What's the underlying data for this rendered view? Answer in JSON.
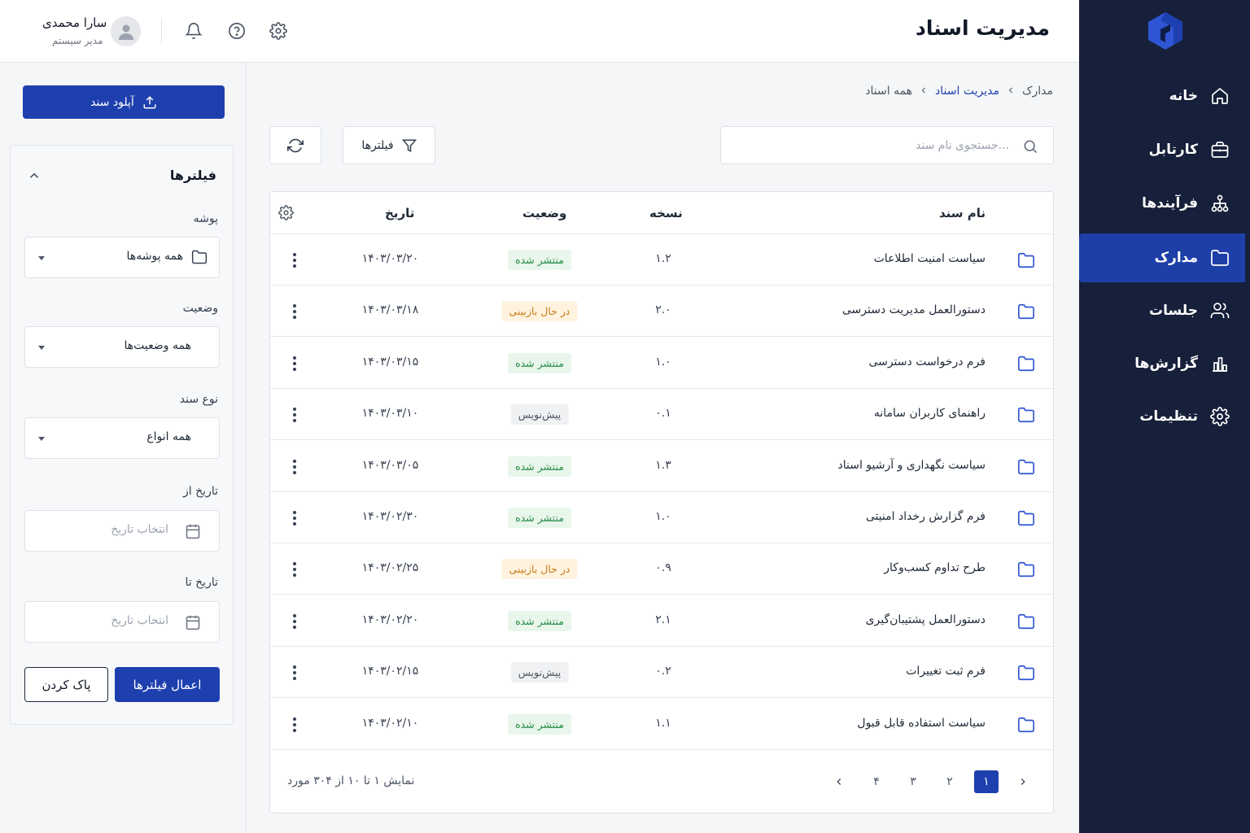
{
  "header": {
    "title": "مدیریت اسناد",
    "user_name": "سارا محمدی",
    "user_role": "مدیر سیستم"
  },
  "icons": {
    "settings": "gear-icon",
    "help": "question-circle-icon",
    "notifications": "bell-icon",
    "avatar": "user-avatar-icon"
  },
  "colors": {
    "nav_bg": "#17203a",
    "nav_active": "#1e3fa8",
    "primary": "#1e40af",
    "published_bg": "#e8f6ec",
    "published_text": "#258b45",
    "review_bg": "#fff3e0",
    "review_text": "#c97a12",
    "draft_bg": "#f0f1f3",
    "draft_text": "#4b5563"
  },
  "nav": {
    "items": [
      {
        "label": "خانه",
        "icon": "home-icon"
      },
      {
        "label": "کارتابل",
        "icon": "briefcase-icon"
      },
      {
        "label": "فرآیندها",
        "icon": "workflow-icon"
      },
      {
        "label": "مدارک",
        "icon": "folder-icon",
        "active": true
      },
      {
        "label": "جلسات",
        "icon": "users-icon"
      },
      {
        "label": "گزارش‌ها",
        "icon": "bar-chart-icon"
      },
      {
        "label": "تنظیمات",
        "icon": "gear-icon"
      }
    ]
  },
  "breadcrumb": [
    "مدارک",
    "مدیریت اسناد",
    "همه اسناد"
  ],
  "toolbar": {
    "search_placeholder": "جستجوی نام سند...",
    "filters_label": "فیلترها"
  },
  "sidebar": {
    "upload_label": "آپلود سند",
    "filters_title": "فیلترها",
    "folder_label": "پوشه",
    "folder_value": "همه پوشه‌ها",
    "status_label": "وضعیت",
    "status_value": "همه وضعیت‌ها",
    "type_label": "نوع سند",
    "type_value": "همه انواع",
    "date_from_label": "تاریخ از",
    "date_to_label": "تاریخ تا",
    "date_placeholder": "انتخاب تاریخ",
    "apply_label": "اعمال فیلترها",
    "clear_label": "پاک کردن"
  },
  "table": {
    "columns": {
      "name": "نام سند",
      "version": "نسخه",
      "status": "وضعیت",
      "date": "تاریخ"
    },
    "rows": [
      {
        "name": "سیاست امنیت اطلاعات",
        "version": "۱.۲",
        "status": "منتشر شده",
        "status_type": "published",
        "date": "۱۴۰۳/۰۳/۲۰"
      },
      {
        "name": "دستورالعمل مدیریت دسترسی",
        "version": "۲.۰",
        "status": "در حال بازبینی",
        "status_type": "review",
        "date": "۱۴۰۳/۰۳/۱۸"
      },
      {
        "name": "فرم درخواست دسترسی",
        "version": "۱.۰",
        "status": "منتشر شده",
        "status_type": "published",
        "date": "۱۴۰۳/۰۳/۱۵"
      },
      {
        "name": "راهنمای کاربران سامانه",
        "version": "۰.۱",
        "status": "پیش‌نویس",
        "status_type": "draft",
        "date": "۱۴۰۳/۰۳/۱۰"
      },
      {
        "name": "سیاست نگهداری و آرشیو اسناد",
        "version": "۱.۳",
        "status": "منتشر شده",
        "status_type": "published",
        "date": "۱۴۰۳/۰۳/۰۵"
      },
      {
        "name": "فرم گزارش رخداد امنیتی",
        "version": "۱.۰",
        "status": "منتشر شده",
        "status_type": "published",
        "date": "۱۴۰۳/۰۲/۳۰"
      },
      {
        "name": "طرح تداوم کسب‌وکار",
        "version": "۰.۹",
        "status": "در حال بازبینی",
        "status_type": "review",
        "date": "۱۴۰۳/۰۲/۲۵"
      },
      {
        "name": "دستورالعمل پشتیبان‌گیری",
        "version": "۲.۱",
        "status": "منتشر شده",
        "status_type": "published",
        "date": "۱۴۰۳/۰۲/۲۰"
      },
      {
        "name": "فرم ثبت تغییرات",
        "version": "۰.۲",
        "status": "پیش‌نویس",
        "status_type": "draft",
        "date": "۱۴۰۳/۰۲/۱۵"
      },
      {
        "name": "سیاست استفاده قابل قبول",
        "version": "۱.۱",
        "status": "منتشر شده",
        "status_type": "published",
        "date": "۱۴۰۳/۰۲/۱۰"
      }
    ]
  },
  "pagination": {
    "info": "نمایش ۱ تا ۱۰ از ۳۰۴ مورد",
    "pages": [
      "۱",
      "۲",
      "۳",
      "۴"
    ],
    "current": "۱"
  }
}
